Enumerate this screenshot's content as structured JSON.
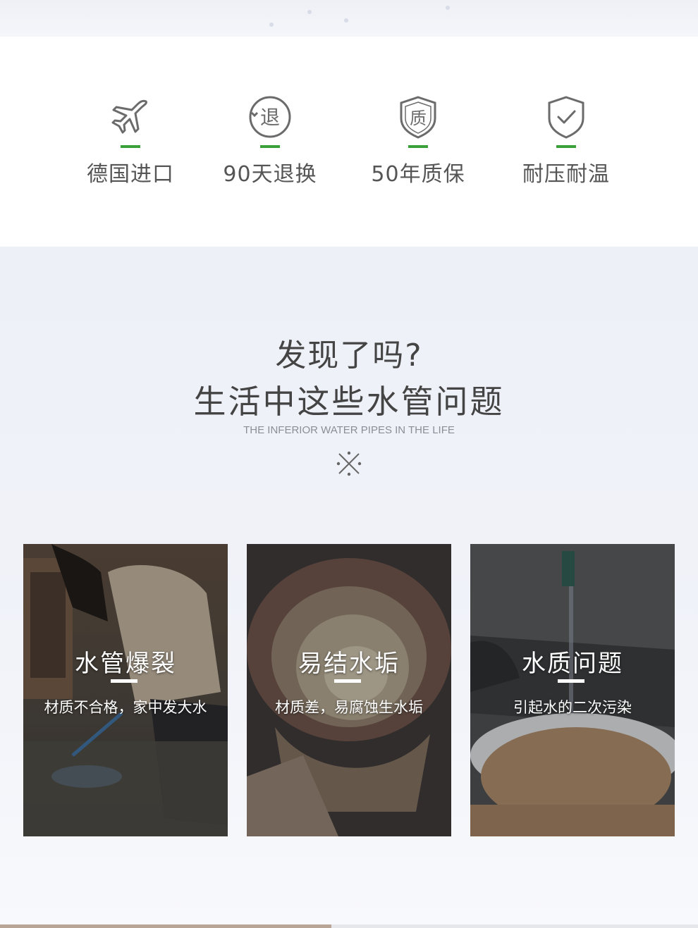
{
  "features": [
    {
      "label": "德国进口",
      "icon": "airplane-icon"
    },
    {
      "label": "90天退换",
      "icon": "return-badge-icon",
      "badge_text": "退"
    },
    {
      "label": "50年质保",
      "icon": "quality-shield-icon",
      "badge_text": "质"
    },
    {
      "label": "耐压耐温",
      "icon": "shield-check-icon"
    }
  ],
  "colors": {
    "accent_green": "#3aa03a",
    "icon_gray": "#6b6b6b",
    "heading_text": "#444444"
  },
  "section": {
    "heading_line1": "发现了吗?",
    "heading_line2": "生活中这些水管问题",
    "subheading": "THE INFERIOR WATER PIPES IN THE LIFE",
    "divider_icon": "asterisk-ornament-icon"
  },
  "cards": [
    {
      "title": "水管爆裂",
      "desc": "材质不合格，家中发大水"
    },
    {
      "title": "易结水垢",
      "desc": "材质差，易腐蚀生水垢"
    },
    {
      "title": "水质问题",
      "desc": "引起水的二次污染"
    }
  ]
}
